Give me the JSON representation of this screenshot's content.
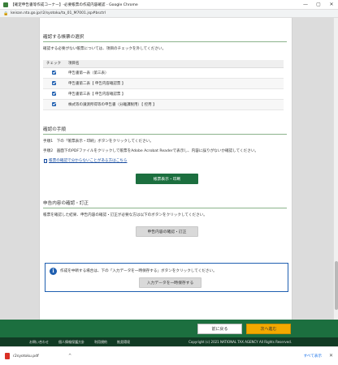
{
  "window": {
    "title": "【確定申告書等作成コーナー】-必要帳票の作成内容確認 - Google Chrome",
    "controls": [
      "—",
      "▢",
      "✕"
    ]
  },
  "address_bar": {
    "url": "keisan.nta.go.jp/r2/syotoku/ta_01_M7001.jsp#bsctrl"
  },
  "select_forms": {
    "heading": "確認する帳票の選択",
    "instruction": "確認する必要がない帳票については、項目のチェックを外してください。",
    "columns": [
      "チェック",
      "項目名"
    ],
    "rows": [
      {
        "label": "申告書第一表（第三表）",
        "checked": true
      },
      {
        "label": "申告書第二表【 申告内容確認票 】",
        "checked": true
      },
      {
        "label": "申告書第三表【 申告内容確認票 】",
        "checked": true
      },
      {
        "label": "株式等の譲渡所得等の申告書（分離課税用）【 控用 】",
        "checked": true
      }
    ]
  },
  "confirm_steps": {
    "heading": "確認の手順",
    "step1": "手順1　下の「帳票表示・印刷」ボタンをクリックしてください。",
    "step2": "手順2　画面下のPDFファイルをクリックして帳票をAdobe Acrobat Readerで表示し、内容に誤りがないか確認してください。",
    "help_link": "帳票の確認で分からないことがある方はこちら",
    "print_button": "帳票表示・印刷"
  },
  "review_section": {
    "heading": "申告内容の確認・訂正",
    "instruction": "帳票を確認した結果、申告内容の確認・訂正が必要な方は以下のボタンをクリックしてください。",
    "button": "申告内容の確認・訂正"
  },
  "save_box": {
    "icon": "info-icon",
    "message": "作成を中断する場合は、下の「入力データを一時保存する」ボタンをクリックしてください。",
    "button": "入力データを一時保存する"
  },
  "footer_nav": {
    "back": "前に戻る",
    "next": "次へ進む"
  },
  "site_footer": {
    "links": [
      "お問い合わせ",
      "個人情報保護方針",
      "利用規約",
      "推奨環境"
    ],
    "copyright": "Copyright (c) 2021 NATIONAL TAX AGENCY All Rights Reserved."
  },
  "download_bar": {
    "file_name": "r2syotoku.pdf",
    "caret": "^",
    "show_all": "すべて表示",
    "close": "✕"
  },
  "colors": {
    "primary_green": "#1c6f3f",
    "footer_dark": "#113b24",
    "accent_orange": "#f2a900",
    "link_blue": "#1a4ea1"
  }
}
